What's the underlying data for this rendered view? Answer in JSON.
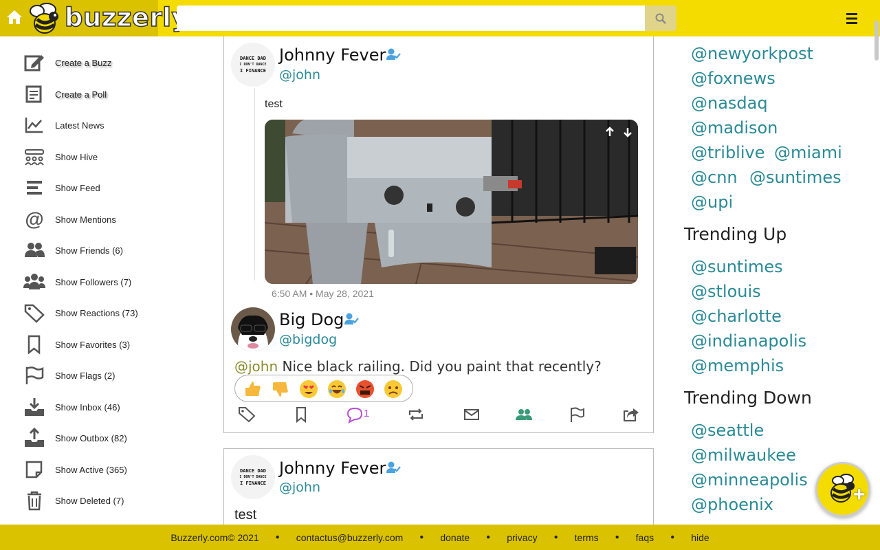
{
  "header": {
    "brand": "buzzerly",
    "search": {
      "value": "",
      "placeholder": ""
    }
  },
  "sidebar": {
    "items": [
      {
        "label": "Create a Buzz",
        "icon": "edit-icon"
      },
      {
        "label": "Create a Poll",
        "icon": "poll-icon"
      },
      {
        "label": "Latest News",
        "icon": "chart-line-icon"
      },
      {
        "label": "Show Hive",
        "icon": "hive-icon"
      },
      {
        "label": "Show Feed",
        "icon": "feed-icon"
      },
      {
        "label": "Show Mentions",
        "icon": "at-icon"
      },
      {
        "label": "Show Friends (6)",
        "icon": "friends-icon"
      },
      {
        "label": "Show Followers (7)",
        "icon": "followers-icon"
      },
      {
        "label": "Show Reactions (73)",
        "icon": "tags-icon"
      },
      {
        "label": "Show Favorites (3)",
        "icon": "bookmark-icon"
      },
      {
        "label": "Show Flags (2)",
        "icon": "flag-icon"
      },
      {
        "label": "Show Inbox (46)",
        "icon": "inbox-icon"
      },
      {
        "label": "Show Outbox (82)",
        "icon": "outbox-icon"
      },
      {
        "label": "Show Active (365)",
        "icon": "note-icon"
      },
      {
        "label": "Show Deleted (7)",
        "icon": "trash-icon"
      }
    ]
  },
  "feed": {
    "post1": {
      "name": "Johnny Fever",
      "handle": "@john",
      "avatar_text": [
        "DANCE DAD",
        "I DON'T DANCE",
        "I FINANCE"
      ],
      "text": "test",
      "timestamp": "6:50 AM • May 28, 2021"
    },
    "reply": {
      "name": "Big Dog",
      "handle": "@bigdog",
      "mention": "@john",
      "text": " Nice black railing. Did you paint that recently?",
      "reply_count": "1"
    },
    "post2": {
      "name": "Johnny Fever",
      "handle": "@john",
      "avatar_text": [
        "DANCE DAD",
        "I DON'T DANCE",
        "I FINANCE"
      ],
      "text": "test"
    }
  },
  "right": {
    "top_tags": [
      "@newyorkpost",
      "@foxnews",
      "@nasdaq",
      "@madison",
      "@triblive",
      "@miami",
      "@cnn",
      "@suntimes",
      "@upi"
    ],
    "trending_up_title": "Trending Up",
    "trending_up": [
      "@suntimes",
      "@stlouis",
      "@charlotte",
      "@indianapolis",
      "@memphis"
    ],
    "trending_down_title": "Trending Down",
    "trending_down": [
      "@seattle",
      "@milwaukee",
      "@minneapolis",
      "@phoenix"
    ]
  },
  "footer": {
    "copyright": "Buzzerly.com© 2021",
    "contact": "contactus@buzzerly.com",
    "donate": "donate",
    "privacy": "privacy",
    "terms": "terms",
    "faqs": "faqs",
    "hide": "hide"
  },
  "colors": {
    "brand_yellow": "#f4db00",
    "brand_dark_yellow": "#dbc200",
    "link_teal": "#2a8a96",
    "verified_blue": "#4aa3df"
  }
}
